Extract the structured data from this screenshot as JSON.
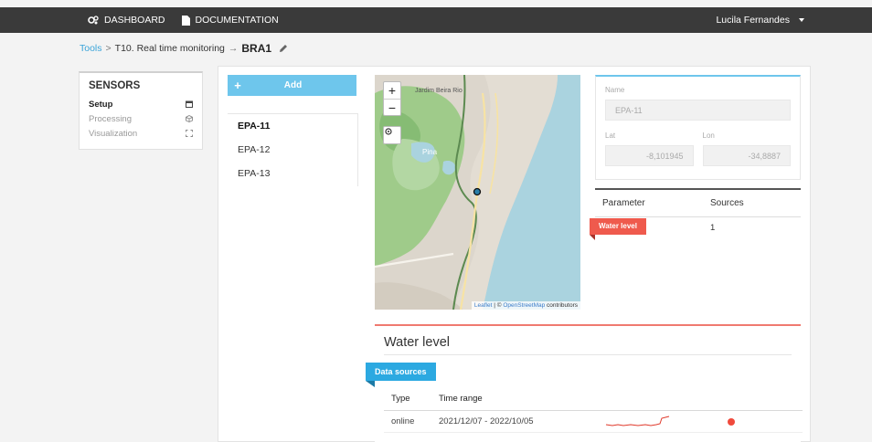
{
  "topbar": {
    "nav": [
      {
        "label": "DASHBOARD",
        "icon": "cogs-icon"
      },
      {
        "label": "DOCUMENTATION",
        "icon": "document-icon"
      }
    ],
    "user": "Lucila Fernandes"
  },
  "breadcrumb": {
    "root": "Tools",
    "separator": ">",
    "project": "T10. Real time monitoring",
    "arrow": "→",
    "current": "BRA1"
  },
  "sidebar": {
    "title": "SENSORS",
    "items": [
      {
        "label": "Setup",
        "icon": "calendar-icon",
        "active": true
      },
      {
        "label": "Processing",
        "icon": "cube-icon",
        "active": false
      },
      {
        "label": "Visualization",
        "icon": "expand-icon",
        "active": false
      }
    ]
  },
  "add_button": {
    "plus": "+",
    "label": "Add"
  },
  "sensors": [
    "EPA-11",
    "EPA-12",
    "EPA-13"
  ],
  "map": {
    "zoom_in": "+",
    "zoom_out": "−",
    "place_labels": [
      "Jardim Beira Rio",
      "Pina"
    ],
    "attribution_leaflet": "Leaflet",
    "attribution_sep": " | © ",
    "attribution_osm": "OpenStreetMap",
    "attribution_tail": " contributors"
  },
  "sensor_info": {
    "name_label": "Name",
    "name_value": "EPA-11",
    "lat_label": "Lat",
    "lat_value": "-8,101945",
    "lon_label": "Lon",
    "lon_value": "-34,8887"
  },
  "parameters": {
    "headers": [
      "Parameter",
      "Sources"
    ],
    "rows": [
      {
        "parameter": "Water level",
        "sources": "1"
      }
    ]
  },
  "water_level": {
    "title": "Water level",
    "tab": "Data sources",
    "headers": [
      "Type",
      "Time range"
    ],
    "rows": [
      {
        "type": "online",
        "range": "2021/12/07 - 2022/10/05",
        "status_color": "#f04a3c"
      }
    ]
  },
  "colors": {
    "accent": "#6ec6ec",
    "badge_blue": "#2ca9e1",
    "badge_red": "#ef5a4d",
    "topbar": "#3a3a3a"
  }
}
